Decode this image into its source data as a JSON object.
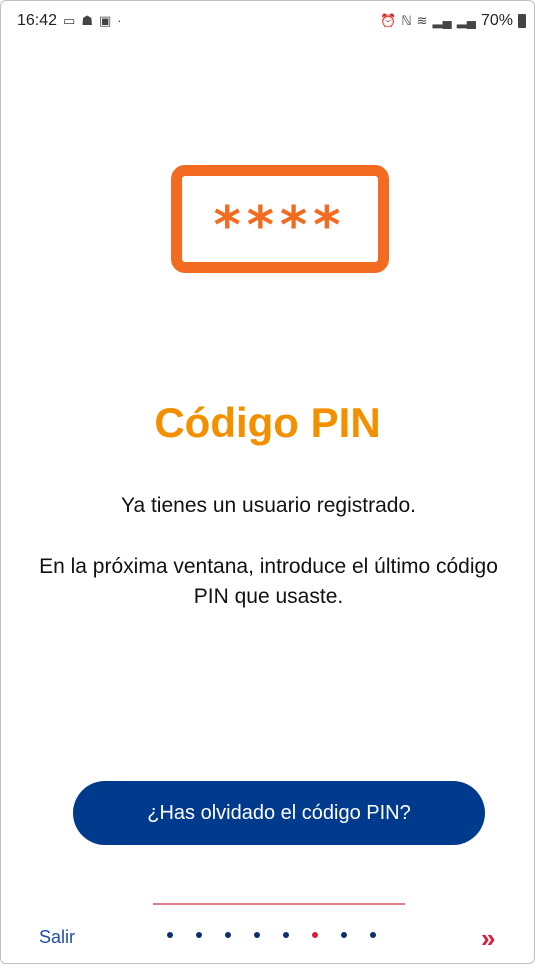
{
  "status_bar": {
    "time": "16:42",
    "battery": "70%",
    "left_icons": [
      "screen-icon",
      "teams-icon",
      "gallery-icon",
      "dot-icon"
    ],
    "right_icons": [
      "alarm-icon",
      "nfc-icon",
      "wifi-icon",
      "signal-icon",
      "signal-icon-2"
    ]
  },
  "illustration": {
    "pin_mask": "****",
    "color": "#f26b21"
  },
  "content": {
    "title": "Código PIN",
    "message_1": "Ya tienes un usuario registrado.",
    "message_2": "En la próxima ventana, introduce el último código PIN que usaste."
  },
  "actions": {
    "forgot_pin_label": "¿Has olvidado el código PIN?",
    "exit_label": "Salir",
    "next_label": "»"
  },
  "pagination": {
    "total": 8,
    "current": 6
  },
  "colors": {
    "accent_orange": "#f39000",
    "button_blue": "#003a8c",
    "accent_red": "#d8203c"
  }
}
